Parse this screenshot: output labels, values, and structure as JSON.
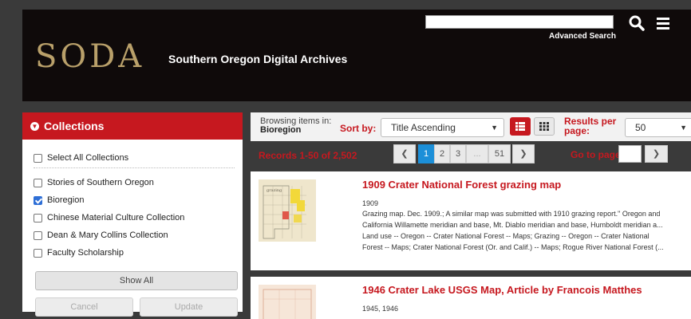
{
  "header": {
    "logo": "SODA",
    "site_title": "Southern Oregon Digital Archives",
    "search_placeholder": "",
    "advanced_search": "Advanced Search",
    "search_icon": "search-icon",
    "menu_icon": "hamburger-menu-icon"
  },
  "sidebar": {
    "title": "Collections",
    "select_all": "Select All Collections",
    "items": [
      {
        "label": "Stories of Southern Oregon",
        "checked": false
      },
      {
        "label": "Bioregion",
        "checked": true
      },
      {
        "label": "Chinese Material Culture Collection",
        "checked": false
      },
      {
        "label": "Dean & Mary Collins Collection",
        "checked": false
      },
      {
        "label": "Faculty Scholarship",
        "checked": false
      }
    ],
    "show_all": "Show All",
    "cancel": "Cancel",
    "update": "Update"
  },
  "toolbar": {
    "browsing_label": "Browsing items in:",
    "browsing_value": "Bioregion",
    "sort_label": "Sort by:",
    "sort_value": "Title Ascending",
    "results_label_1": "Results per",
    "results_label_2": "page:",
    "results_value": "50"
  },
  "pagination": {
    "records_text": "Records 1-50 of 2,502",
    "pages": [
      "1",
      "2",
      "3",
      "...",
      "51"
    ],
    "current": "1",
    "goto_label": "Go to page"
  },
  "results": [
    {
      "title": "1909 Crater National Forest grazing map",
      "year": "1909",
      "desc_lines": [
        "Grazing map. Dec. 1909.; A similar map was submitted with 1910 grazing report.\" Oregon and",
        "California Willamette meridian and base, Mt. Diablo meridian and base, Humboldt meridian a...",
        "Land use -- Oregon -- Crater National Forest -- Maps; Grazing -- Oregon -- Crater National",
        "Forest -- Maps; Crater National Forest (Or. and Calif.) -- Maps; Rogue River National Forest (..."
      ]
    },
    {
      "title": "1946 Crater Lake USGS Map, Article by Francois Matthes",
      "year": "1945, 1946",
      "desc_lines": []
    }
  ],
  "colors": {
    "accent": "#c6181f",
    "pagination_active": "#1c8fd8",
    "header_bg": "#0f0a0a",
    "logo": "#b9a06a"
  }
}
